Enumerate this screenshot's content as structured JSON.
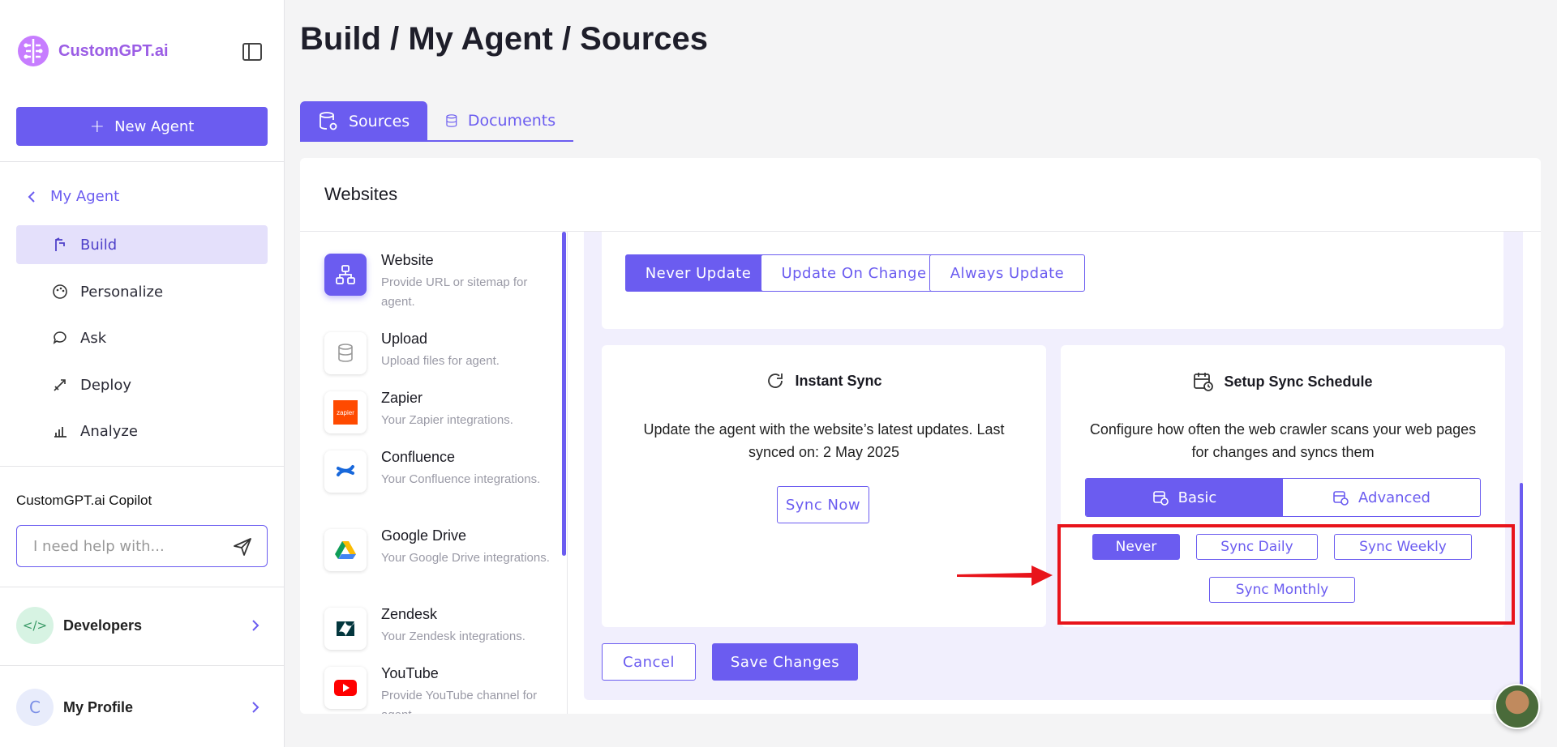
{
  "app": {
    "brand": "CustomGPT.ai"
  },
  "sidebar": {
    "new_agent": "New Agent",
    "back_label": "My Agent",
    "items": [
      {
        "label": "Build",
        "icon": "build-icon",
        "active": true
      },
      {
        "label": "Personalize",
        "icon": "palette-icon"
      },
      {
        "label": "Ask",
        "icon": "chat-icon"
      },
      {
        "label": "Deploy",
        "icon": "rocket-icon"
      },
      {
        "label": "Analyze",
        "icon": "bar-chart-icon"
      }
    ],
    "copilot_title": "CustomGPT.ai Copilot",
    "copilot_placeholder": "I need help with...",
    "developers": "Developers",
    "profile": "My Profile",
    "profile_initial": "C"
  },
  "header": {
    "title": "Build / My Agent / Sources"
  },
  "tabs": [
    {
      "label": "Sources",
      "active": true
    },
    {
      "label": "Documents"
    }
  ],
  "card": {
    "title": "Websites"
  },
  "sources": [
    {
      "name": "Website",
      "desc": "Provide URL or sitemap for agent.",
      "active": true
    },
    {
      "name": "Upload",
      "desc": "Upload files for agent."
    },
    {
      "name": "Zapier",
      "desc": "Your Zapier integrations."
    },
    {
      "name": "Confluence",
      "desc": "Your Confluence integrations."
    },
    {
      "name": "Google Drive",
      "desc": "Your Google Drive integrations."
    },
    {
      "name": "Zendesk",
      "desc": "Your Zendesk integrations."
    },
    {
      "name": "YouTube",
      "desc": "Provide YouTube channel for agent."
    }
  ],
  "update_options": [
    "Never Update",
    "Update On Change",
    "Always Update"
  ],
  "instant_sync": {
    "title": "Instant Sync",
    "desc": "Update the agent with the website’s latest updates. Last synced on: 2 May 2025",
    "button": "Sync Now"
  },
  "schedule": {
    "title": "Setup Sync Schedule",
    "desc": "Configure how often the web crawler scans your web pages for changes and syncs them",
    "modes": [
      "Basic",
      "Advanced"
    ],
    "options": [
      "Never",
      "Sync Daily",
      "Sync Weekly",
      "Sync Monthly"
    ]
  },
  "actions": {
    "cancel": "Cancel",
    "save": "Save Changes"
  },
  "colors": {
    "accent": "#6b5cf0",
    "highlight": "#e8141b"
  }
}
